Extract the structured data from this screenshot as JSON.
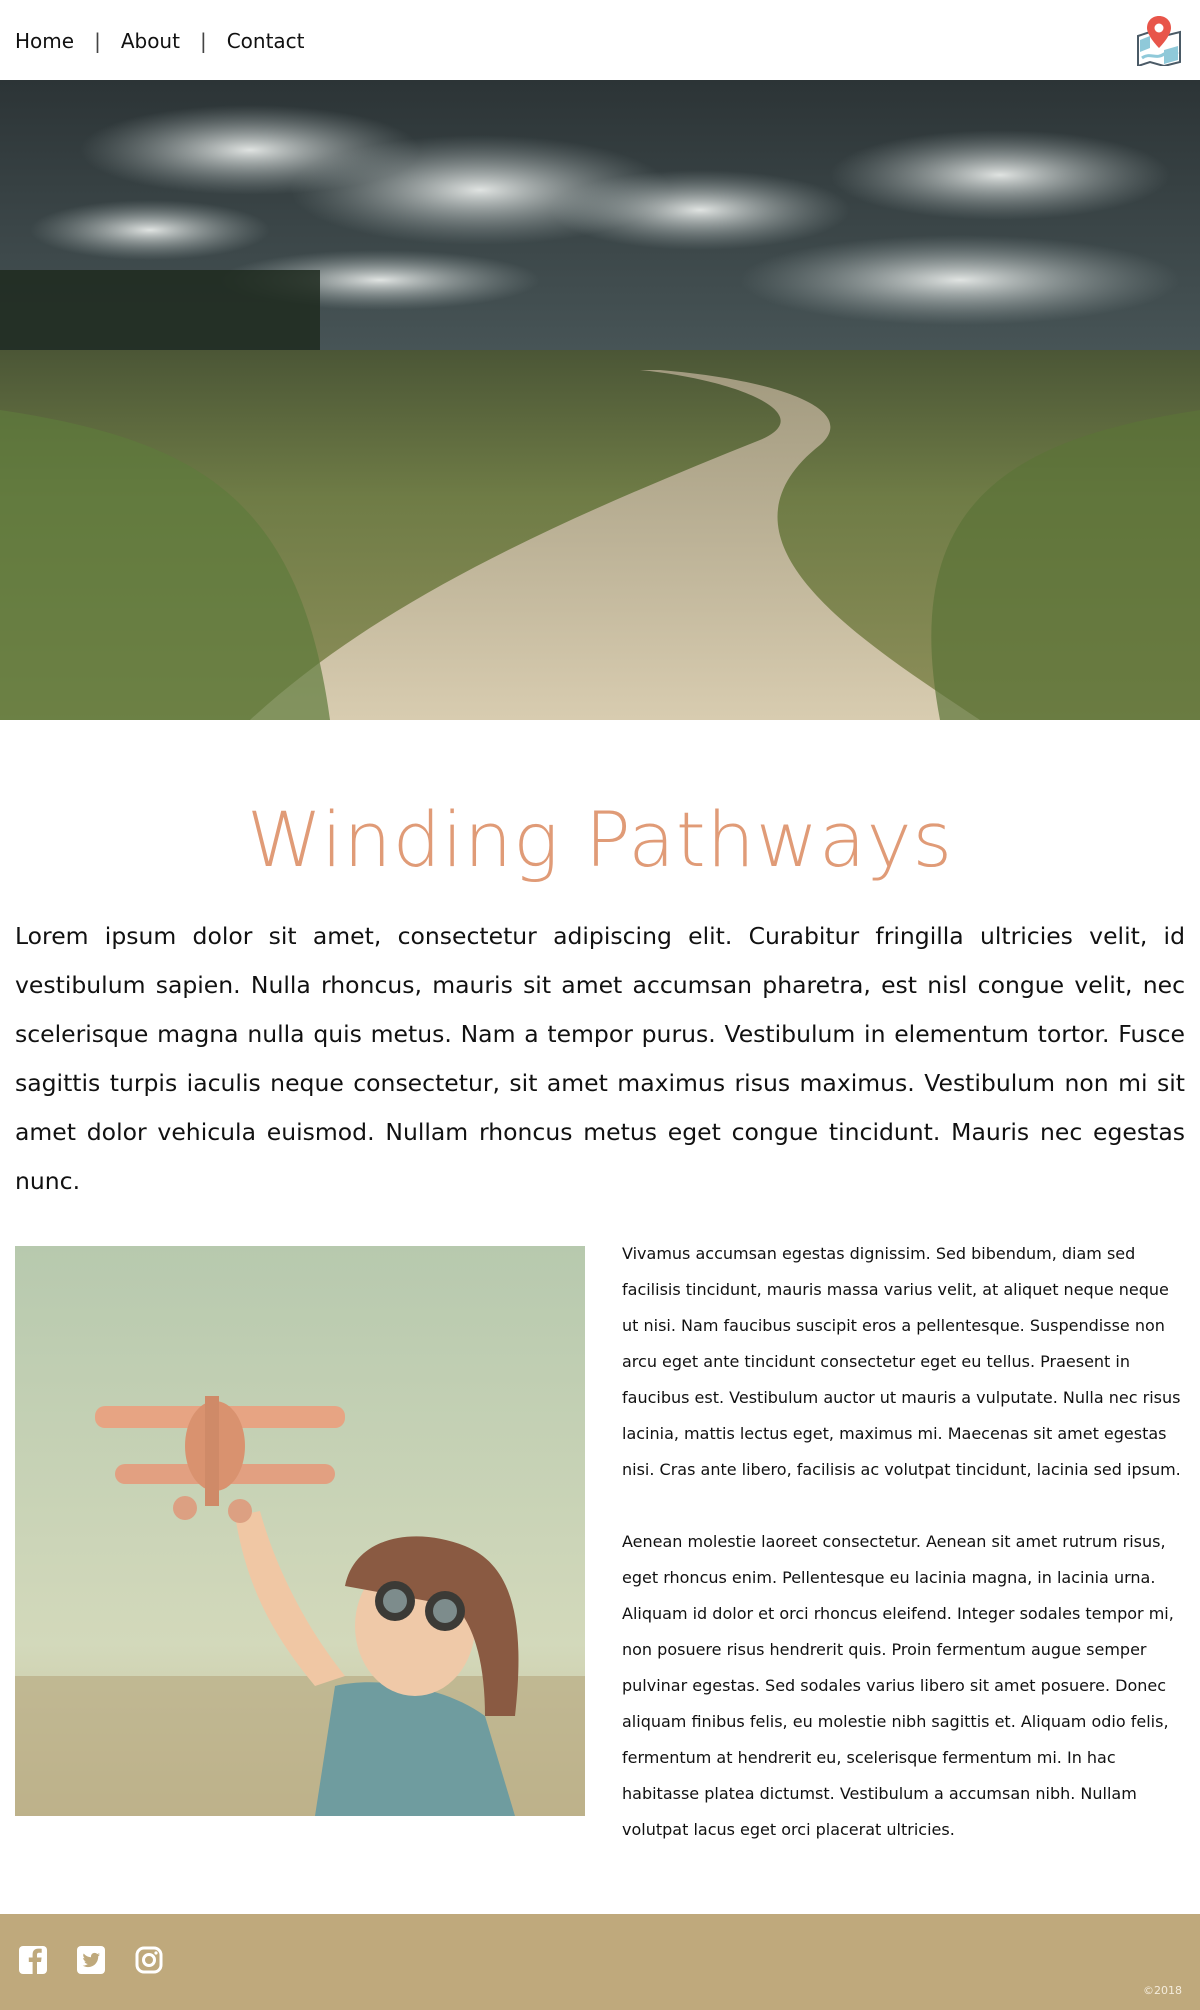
{
  "nav": {
    "items": [
      {
        "label": "Home"
      },
      {
        "label": "About"
      },
      {
        "label": "Contact"
      }
    ],
    "separator": "|"
  },
  "icons": {
    "map": "map-pin-icon",
    "facebook": "facebook-icon",
    "twitter": "twitter-icon",
    "instagram": "instagram-icon"
  },
  "main": {
    "title": "Winding Pathways",
    "lead": "Lorem ipsum dolor sit amet, consectetur adipiscing elit. Curabitur fringilla ultricies velit, id vestibulum sapien. Nulla rhoncus, mauris sit amet accumsan pharetra, est nisl congue velit, nec scelerisque magna nulla quis metus. Nam a tempor purus. Vestibulum in elementum tortor. Fusce sagittis turpis iaculis neque consectetur, sit amet maximus risus maximus. Vestibulum non mi sit amet dolor vehicula euismod. Nullam rhoncus metus eget congue tincidunt. Mauris nec egestas nunc.",
    "paragraphs": [
      "Vivamus accumsan egestas dignissim. Sed bibendum, diam sed facilisis tincidunt, mauris massa varius velit, at aliquet neque neque ut nisi. Nam faucibus suscipit eros a pellentesque. Suspendisse non arcu eget ante tincidunt consectetur eget eu tellus. Praesent in faucibus est. Vestibulum auctor ut mauris a vulputate. Nulla nec risus lacinia, mattis lectus eget, maximus mi. Maecenas sit amet egestas nisi. Cras ante libero, facilisis ac volutpat tincidunt, lacinia sed ipsum.",
      "Aenean molestie laoreet consectetur. Aenean sit amet rutrum risus, eget rhoncus enim. Pellentesque eu lacinia magna, in lacinia urna. Aliquam id dolor et orci rhoncus eleifend. Integer sodales tempor mi, non posuere risus hendrerit quis. Proin fermentum augue semper pulvinar egestas. Sed sodales varius libero sit amet posuere. Donec aliquam finibus felis, eu molestie nibh sagittis et. Aliquam odio felis, fermentum at hendrerit eu, scelerisque fermentum mi. In hac habitasse platea dictumst. Vestibulum a accumsan nibh. Nullam volutpat lacus eget orci placerat ultricies."
    ]
  },
  "footer": {
    "copyright": "©2018"
  },
  "colors": {
    "title": "#e09b77",
    "footer": "#bfa97c"
  }
}
